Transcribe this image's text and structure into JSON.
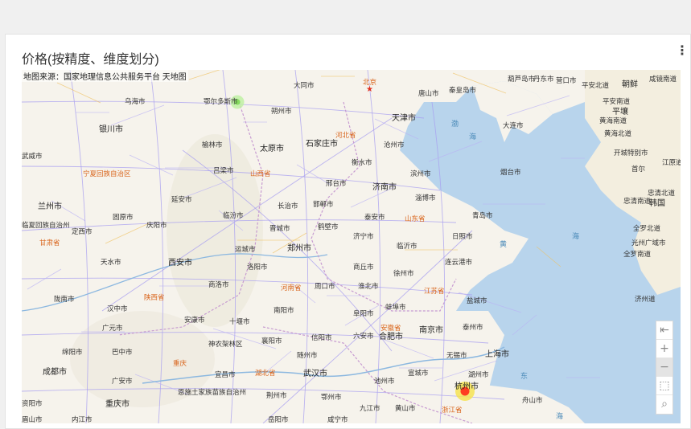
{
  "card": {
    "title": "价格(按精度、维度划分)",
    "menu_icon": "vertical-ellipsis-icon"
  },
  "map": {
    "source": "地图来源：国家地理信息公共服务平台 天地图",
    "controls": [
      {
        "name": "reset-north-button",
        "icon": "compass-arrow-icon",
        "glyph": "⇤"
      },
      {
        "name": "zoom-in-button",
        "icon": "plus-icon",
        "glyph": "+"
      },
      {
        "name": "zoom-out-button",
        "icon": "minus-icon",
        "glyph": "−"
      },
      {
        "name": "select-button",
        "icon": "cursor-select-icon",
        "glyph": "⬚"
      },
      {
        "name": "search-button",
        "icon": "magnifier-icon",
        "glyph": "⌕"
      }
    ],
    "capital_label": "北京",
    "cities": [
      {
        "n": "大同市"
      },
      {
        "n": "乌海市"
      },
      {
        "n": "鄂尔多斯市"
      },
      {
        "n": "朔州市"
      },
      {
        "n": "唐山市"
      },
      {
        "n": "秦皇岛市"
      },
      {
        "n": "天津市"
      },
      {
        "n": "葫芦岛市"
      },
      {
        "n": "银川市"
      },
      {
        "n": "榆林市"
      },
      {
        "n": "太原市"
      },
      {
        "n": "石家庄市"
      },
      {
        "n": "沧州市"
      },
      {
        "n": "大连市"
      },
      {
        "n": "武威市"
      },
      {
        "n": "吕梁市"
      },
      {
        "n": "衡水市"
      },
      {
        "n": "滨州市"
      },
      {
        "n": "烟台市"
      },
      {
        "n": "延安市"
      },
      {
        "n": "邢台市"
      },
      {
        "n": "济南市"
      },
      {
        "n": "淄博市"
      },
      {
        "n": "兰州市"
      },
      {
        "n": "固原市"
      },
      {
        "n": "庆阳市"
      },
      {
        "n": "临汾市"
      },
      {
        "n": "长治市"
      },
      {
        "n": "邯郸市"
      },
      {
        "n": "泰安市"
      },
      {
        "n": "青岛市"
      },
      {
        "n": "临夏回族自治州"
      },
      {
        "n": "定西市"
      },
      {
        "n": "晋城市"
      },
      {
        "n": "鹤壁市"
      },
      {
        "n": "济宁市"
      },
      {
        "n": "日照市"
      },
      {
        "n": "运城市"
      },
      {
        "n": "临沂市"
      },
      {
        "n": "天水市"
      },
      {
        "n": "西安市"
      },
      {
        "n": "洛阳市"
      },
      {
        "n": "郑州市"
      },
      {
        "n": "商丘市"
      },
      {
        "n": "徐州市"
      },
      {
        "n": "连云港市"
      },
      {
        "n": "商洛市"
      },
      {
        "n": "周口市"
      },
      {
        "n": "淮北市"
      },
      {
        "n": "陇南市"
      },
      {
        "n": "汉中市"
      },
      {
        "n": "南阳市"
      },
      {
        "n": "阜阳市"
      },
      {
        "n": "蚌埠市"
      },
      {
        "n": "盐城市"
      },
      {
        "n": "广元市"
      },
      {
        "n": "安康市"
      },
      {
        "n": "十堰市"
      },
      {
        "n": "六安市"
      },
      {
        "n": "南京市"
      },
      {
        "n": "泰州市"
      },
      {
        "n": "神农架林区"
      },
      {
        "n": "襄阳市"
      },
      {
        "n": "信阳市"
      },
      {
        "n": "合肥市"
      },
      {
        "n": "绵阳市"
      },
      {
        "n": "巴中市"
      },
      {
        "n": "随州市"
      },
      {
        "n": "无锡市"
      },
      {
        "n": "上海市"
      },
      {
        "n": "成都市"
      },
      {
        "n": "广安市"
      },
      {
        "n": "宜昌市"
      },
      {
        "n": "武汉市"
      },
      {
        "n": "池州市"
      },
      {
        "n": "宣城市"
      },
      {
        "n": "湖州市"
      },
      {
        "n": "资阳市"
      },
      {
        "n": "重庆市"
      },
      {
        "n": "恩施土家族苗族自治州"
      },
      {
        "n": "荆州市"
      },
      {
        "n": "鄂州市"
      },
      {
        "n": "九江市"
      },
      {
        "n": "黄山市"
      },
      {
        "n": "杭州市"
      },
      {
        "n": "舟山市"
      },
      {
        "n": "眉山市"
      },
      {
        "n": "内江市"
      },
      {
        "n": "岳阳市"
      },
      {
        "n": "咸宁市"
      },
      {
        "n": "丹东市"
      },
      {
        "n": "平安北道"
      },
      {
        "n": "朝鲜"
      },
      {
        "n": "咸镜南道"
      },
      {
        "n": "平安南道"
      },
      {
        "n": "平壤"
      },
      {
        "n": "黄海北道"
      },
      {
        "n": "开城特别市"
      },
      {
        "n": "首尔"
      },
      {
        "n": "江原道"
      },
      {
        "n": "韩国"
      },
      {
        "n": "忠清北道"
      },
      {
        "n": "忠清南道"
      },
      {
        "n": "全罗北道"
      },
      {
        "n": "光州广域市"
      },
      {
        "n": "全罗南道"
      },
      {
        "n": "济州道"
      },
      {
        "n": "黄海南道"
      },
      {
        "n": "营口市"
      }
    ],
    "provinces": [
      {
        "n": "河北省"
      },
      {
        "n": "山西省"
      },
      {
        "n": "宁夏回族自治区"
      },
      {
        "n": "山东省"
      },
      {
        "n": "甘肃省"
      },
      {
        "n": "陕西省"
      },
      {
        "n": "河南省"
      },
      {
        "n": "江苏省"
      },
      {
        "n": "安徽省"
      },
      {
        "n": "湖北省"
      },
      {
        "n": "重庆"
      },
      {
        "n": "浙江省"
      }
    ],
    "seas": [
      {
        "n": "渤"
      },
      {
        "n": "海"
      },
      {
        "n": "黄"
      },
      {
        "n": "海"
      },
      {
        "n": "东"
      },
      {
        "n": "海"
      }
    ],
    "heat_points": [
      {
        "city": "鄂尔多斯市",
        "intensity": 0.3,
        "color": "#7ed957"
      },
      {
        "city": "杭州市",
        "intensity": 1.0,
        "color": "#ff2a1a"
      }
    ]
  }
}
